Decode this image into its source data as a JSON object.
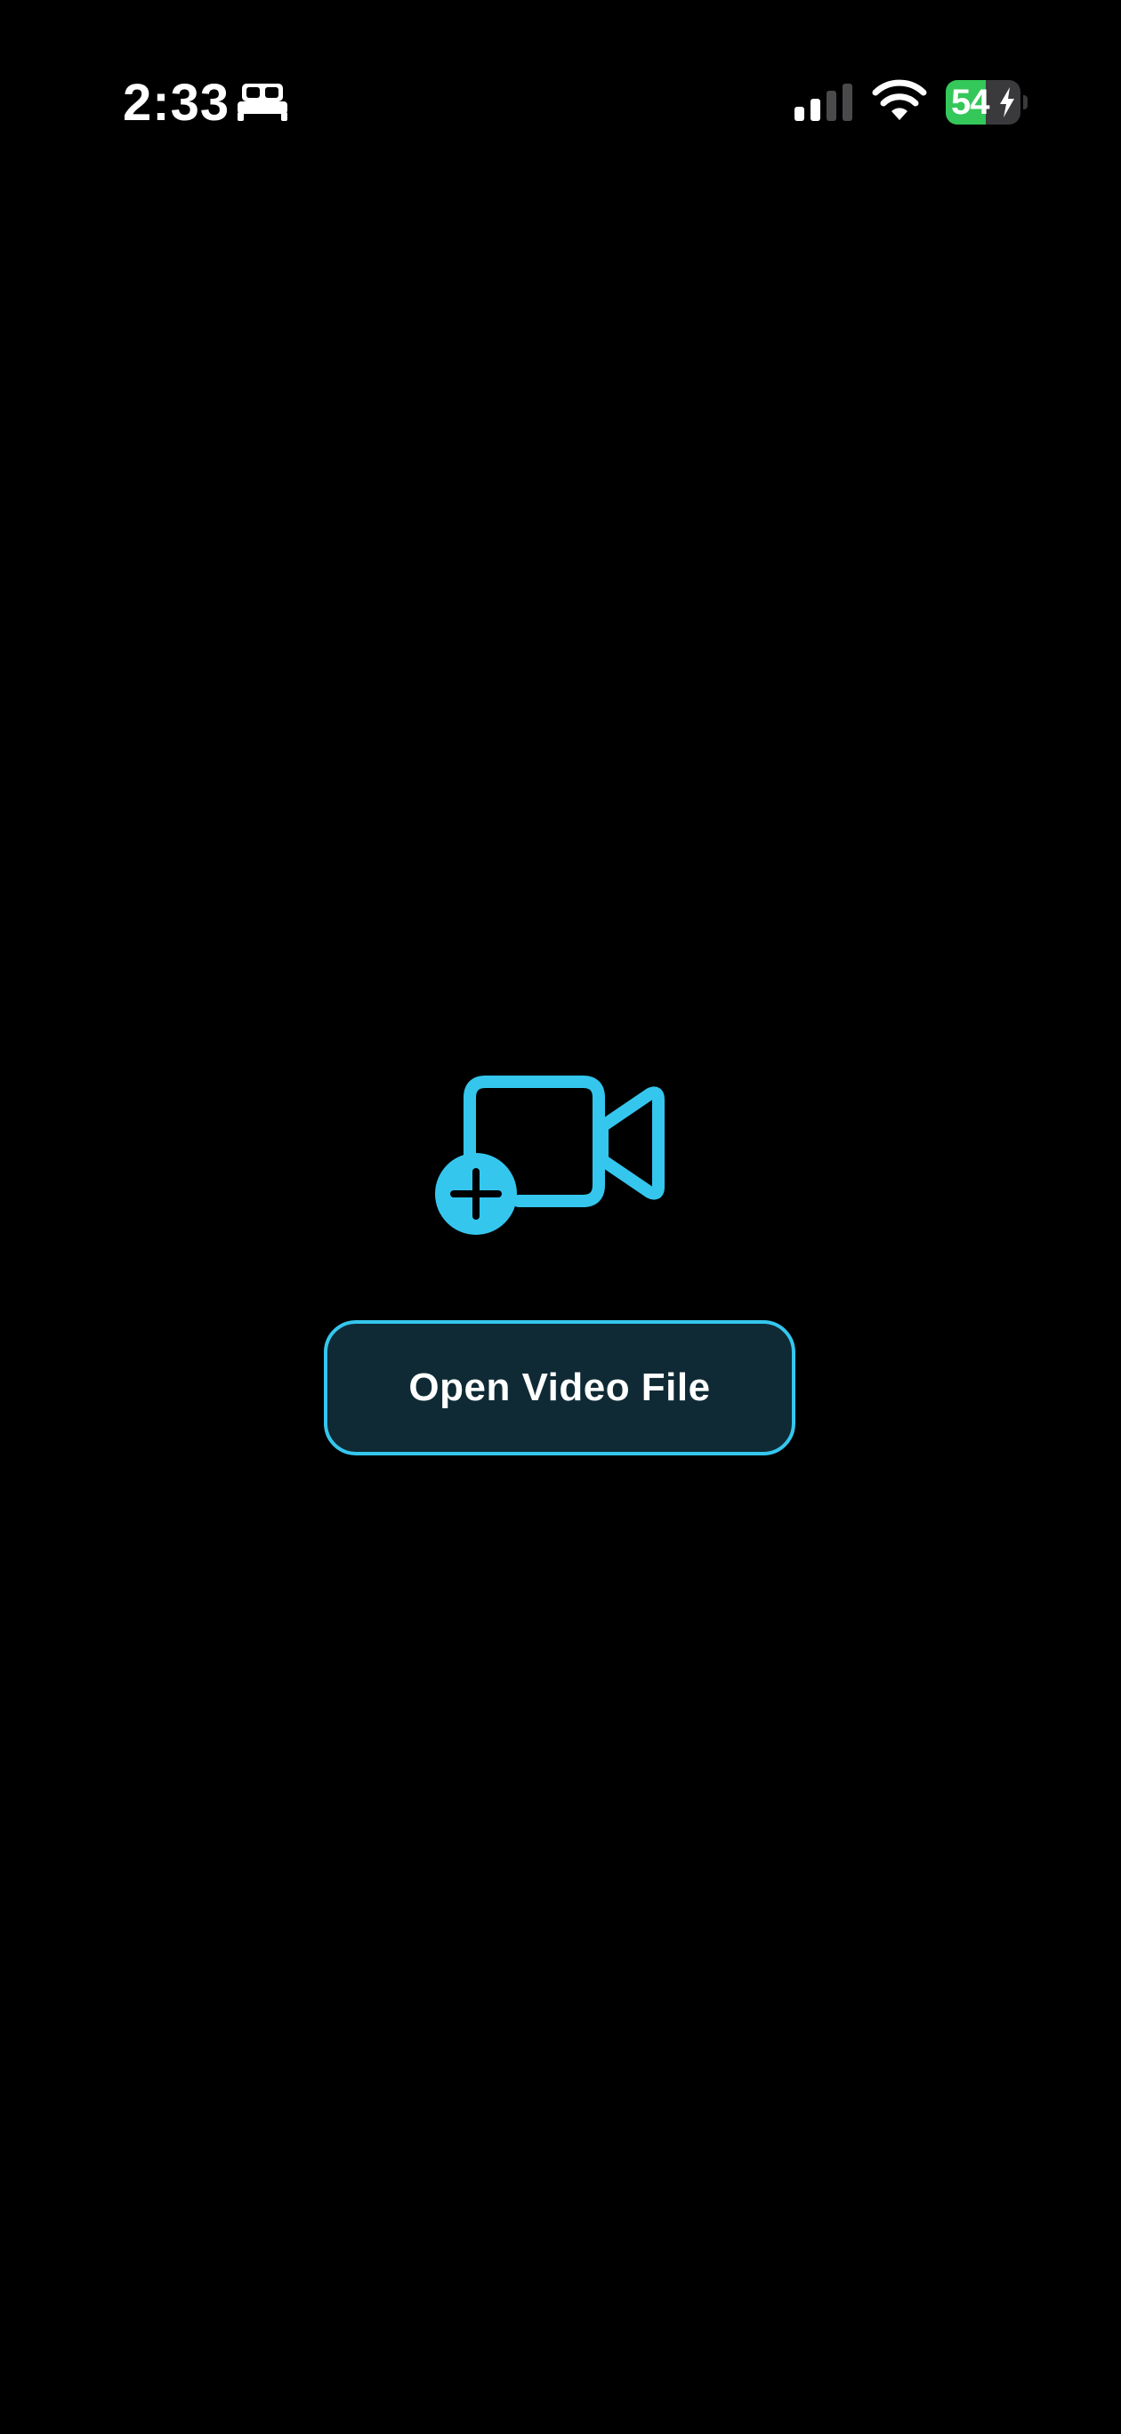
{
  "status_bar": {
    "time": "2:33",
    "focus_icon": "bed-icon",
    "signal_icon": "cellular-signal-icon",
    "wifi_icon": "wifi-icon",
    "battery_level": "54",
    "battery_fraction": 0.54,
    "battery_charging": true,
    "battery_color": "#34c759"
  },
  "main": {
    "icon": "video-add-icon",
    "open_button_label": "Open Video File"
  },
  "colors": {
    "background": "#000000",
    "accent": "#35c6ee",
    "button_fill": "#0f2a35",
    "text": "#ffffff"
  }
}
